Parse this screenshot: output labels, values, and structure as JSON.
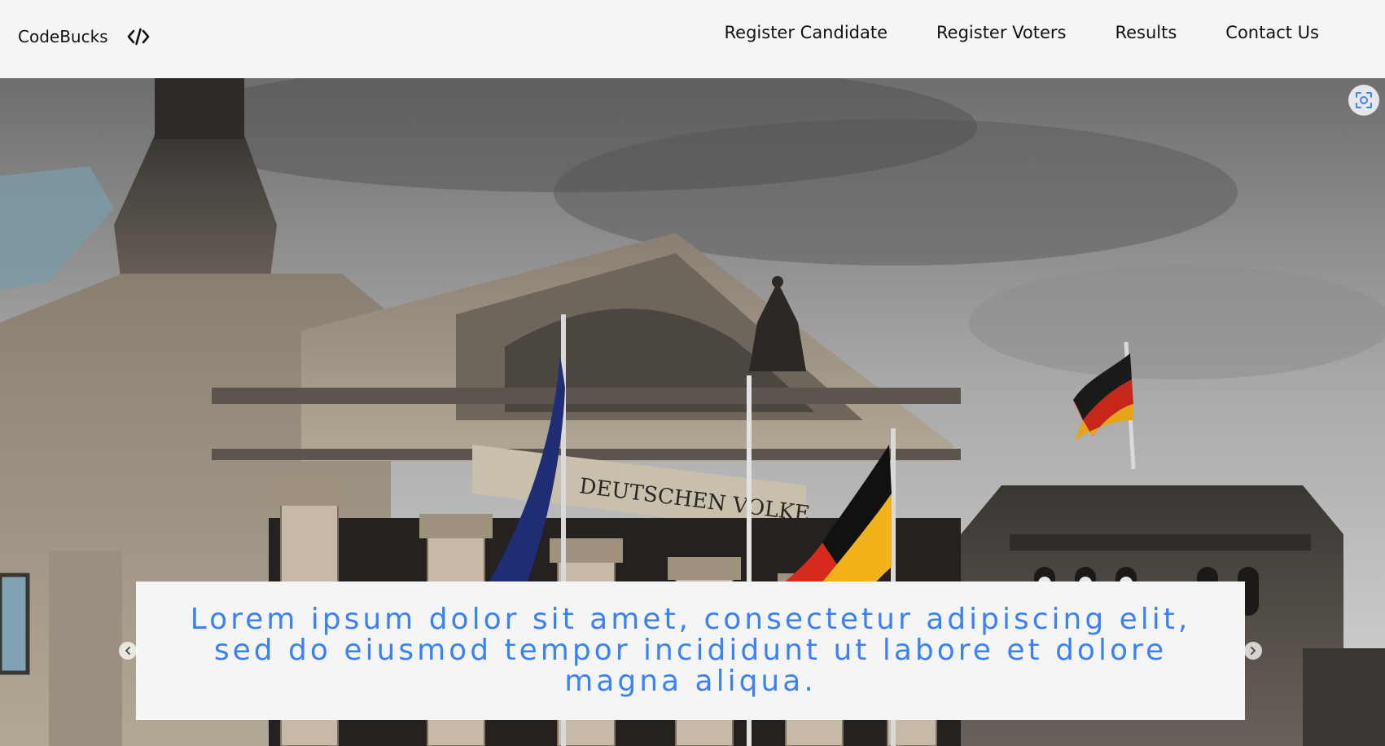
{
  "navbar": {
    "brand_text": "CodeBucks",
    "brand_icon": "code-icon",
    "links": [
      {
        "label": "Register Candidate"
      },
      {
        "label": "Register Voters"
      },
      {
        "label": "Results"
      },
      {
        "label": "Contact Us"
      }
    ]
  },
  "hero": {
    "image_subject": "reichstag-building-with-flags",
    "inscription": "DEUTSCHEN VOLKE",
    "caption": "Lorem ipsum dolor sit amet, consectetur adipiscing elit, sed do eiusmod tempor incididunt ut labore et dolore magna aliqua.",
    "caption_color": "#3b82f6",
    "scan_icon": "scan-icon",
    "prev_icon": "chevron-left-icon",
    "next_icon": "chevron-right-icon"
  },
  "colors": {
    "navbar_bg": "#f5f5f5",
    "caption_bg": "#f5f5f5",
    "text": "#111111",
    "accent": "#3b82f6"
  }
}
